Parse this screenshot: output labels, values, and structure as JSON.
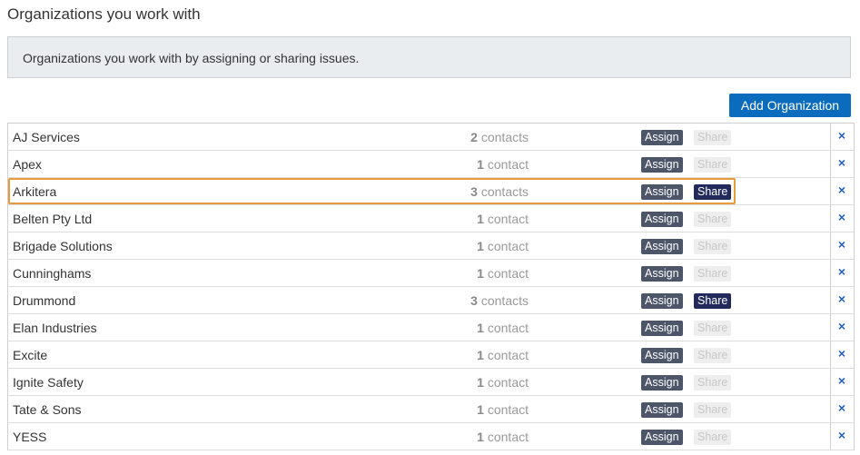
{
  "page": {
    "title": "Organizations you work with",
    "info": "Organizations you work with by assigning or sharing issues.",
    "add_button": "Add Organization"
  },
  "organizations": [
    {
      "name": "AJ Services",
      "count": "2",
      "unit": "contacts",
      "assign": "Assign",
      "share": "Share",
      "shared": false
    },
    {
      "name": "Apex",
      "count": "1",
      "unit": "contact",
      "assign": "Assign",
      "share": "Share",
      "shared": false
    },
    {
      "name": "Arkitera",
      "count": "3",
      "unit": "contacts",
      "assign": "Assign",
      "share": "Share",
      "shared": true
    },
    {
      "name": "Belten Pty Ltd",
      "count": "1",
      "unit": "contact",
      "assign": "Assign",
      "share": "Share",
      "shared": false
    },
    {
      "name": "Brigade Solutions",
      "count": "1",
      "unit": "contact",
      "assign": "Assign",
      "share": "Share",
      "shared": false
    },
    {
      "name": "Cunninghams",
      "count": "1",
      "unit": "contact",
      "assign": "Assign",
      "share": "Share",
      "shared": false
    },
    {
      "name": "Drummond",
      "count": "3",
      "unit": "contacts",
      "assign": "Assign",
      "share": "Share",
      "shared": true
    },
    {
      "name": "Elan Industries",
      "count": "1",
      "unit": "contact",
      "assign": "Assign",
      "share": "Share",
      "shared": false
    },
    {
      "name": "Excite",
      "count": "1",
      "unit": "contact",
      "assign": "Assign",
      "share": "Share",
      "shared": false
    },
    {
      "name": "Ignite Safety",
      "count": "1",
      "unit": "contact",
      "assign": "Assign",
      "share": "Share",
      "shared": false
    },
    {
      "name": "Tate & Sons",
      "count": "1",
      "unit": "contact",
      "assign": "Assign",
      "share": "Share",
      "shared": false
    },
    {
      "name": "YESS",
      "count": "1",
      "unit": "contact",
      "assign": "Assign",
      "share": "Share",
      "shared": false
    }
  ],
  "remove_icon": {
    "icon": "close-icon",
    "glyph": "×"
  },
  "colors": {
    "accent": "#0b6cbd",
    "assign_button": "#4d5569",
    "share_active": "#222a5c",
    "share_inactive": "#eeeeee",
    "highlight": "#e89a3c",
    "remove_icon": "#1f5fbf"
  }
}
